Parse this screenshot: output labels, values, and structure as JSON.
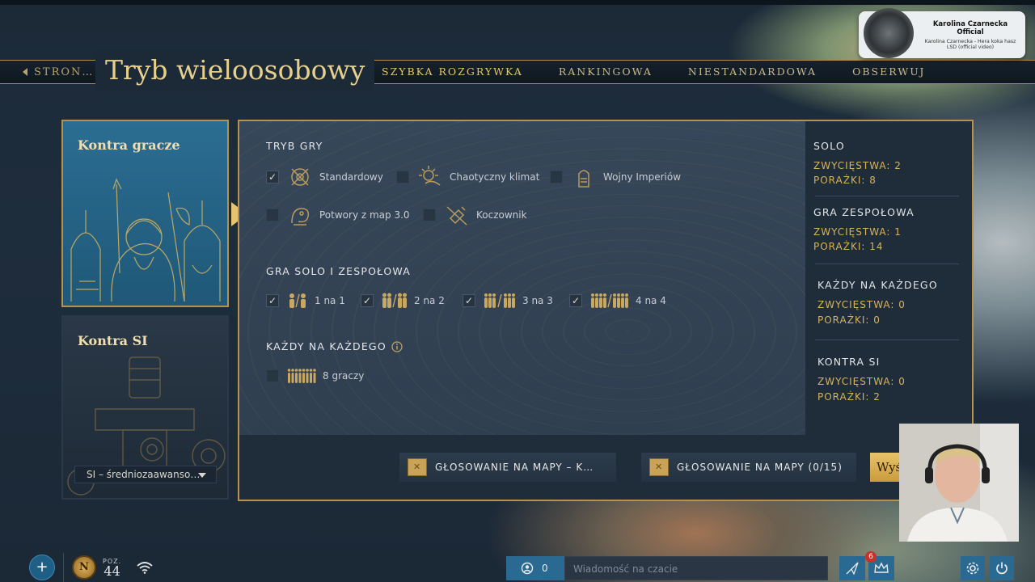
{
  "header": {
    "back_label": "STRON…",
    "title": "Tryb wieloosobowy",
    "tabs": [
      {
        "label": "SZYBKA ROZGRYWKA",
        "active": true
      },
      {
        "label": "RANKINGOWA",
        "active": false
      },
      {
        "label": "NIESTANDARDOWA",
        "active": false
      },
      {
        "label": "OBSERWUJ",
        "active": false
      }
    ]
  },
  "notification": {
    "channel": "Karolina Czarnecka Official",
    "video": "Karolina Czarnecka - Hera koka hasz LSD (official video)"
  },
  "modes": {
    "vs_players": "Kontra gracze",
    "vs_ai": "Kontra SI",
    "ai_difficulty": "SI – średniozaawanso…"
  },
  "game_mode": {
    "title": "TRYB GRY",
    "options": [
      {
        "label": "Standardowy",
        "checked": true,
        "icon": "standard-mode-icon"
      },
      {
        "label": "Chaotyczny klimat",
        "checked": false,
        "icon": "chaotic-climate-icon"
      },
      {
        "label": "Wojny Imperiów",
        "checked": false,
        "icon": "empire-wars-icon"
      },
      {
        "label": "Potwory z map 3.0",
        "checked": false,
        "icon": "monsters-icon"
      },
      {
        "label": "Koczownik",
        "checked": false,
        "icon": "nomad-icon"
      }
    ]
  },
  "solo_team": {
    "title": "GRA SOLO I ZESPOŁOWA",
    "options": [
      {
        "label": "1 na 1",
        "checked": true
      },
      {
        "label": "2 na 2",
        "checked": true
      },
      {
        "label": "3 na 3",
        "checked": true
      },
      {
        "label": "4 na 4",
        "checked": true
      }
    ]
  },
  "ffa": {
    "title": "KAŻDY NA KAŻDEGO",
    "option": {
      "label": "8 graczy",
      "checked": false
    }
  },
  "stats": [
    {
      "title": "SOLO",
      "wins": "ZWYCIĘSTWA: 2",
      "losses": "PORAŻKI: 8"
    },
    {
      "title": "GRA ZESPOŁOWA",
      "wins": "ZWYCIĘSTWA: 1",
      "losses": "PORAŻKI: 14"
    },
    {
      "title": "KAŻDY NA KAŻDEGO",
      "wins": "ZWYCIĘSTWA: 0",
      "losses": "PORAŻKI: 0"
    },
    {
      "title": "KONTRA SI",
      "wins": "ZWYCIĘSTWA: 0",
      "losses": "PORAŻKI: 2"
    }
  ],
  "actions": {
    "vote_maps_1": "GŁOSOWANIE NA MAPY – K…",
    "vote_maps_2": "GŁOSOWANIE NA MAPY (0/15)",
    "send": "Wyślij"
  },
  "bottom": {
    "plus": "+",
    "rank_letter": "N",
    "level_label": "POZ.",
    "level_value": "44",
    "friends_count": "0",
    "chat_placeholder": "Wiadomość na czacie",
    "notifications": "6"
  },
  "colors": {
    "gold": "#d6b35d",
    "accent_blue": "#2a6a92",
    "panel_border": "#b8924c"
  }
}
